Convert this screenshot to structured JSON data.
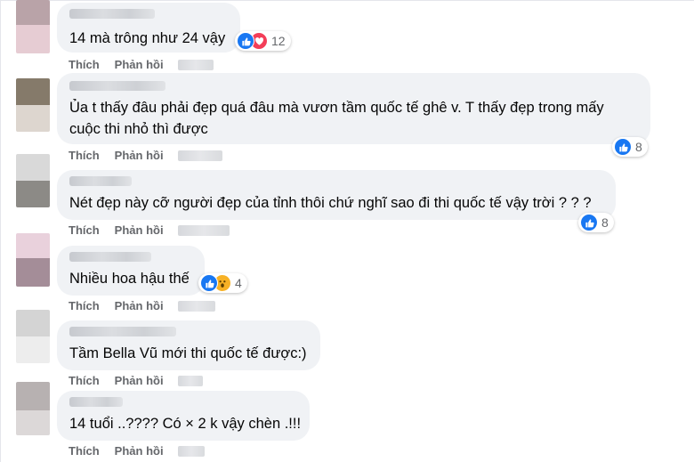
{
  "actions": {
    "like": "Thích",
    "reply": "Phản hồi"
  },
  "colors": {
    "bubble": "#f0f2f5",
    "like": "#1877f2",
    "love": "#f33e58",
    "wow": "#f7b125",
    "meta": "#65676b"
  },
  "comments": [
    {
      "lines": [
        "14 mà trông như 24 vậy"
      ],
      "reactions": [
        "like-icon",
        "love-icon"
      ],
      "count": "12"
    },
    {
      "lines": [
        "Ủa t thấy đâu phải đẹp quá đâu mà vươn tầm quốc tế ghê v. T thấy đẹp trong mấy",
        "cuộc thi nhỏ thì được"
      ],
      "reactions": [
        "like-icon"
      ],
      "count": "8"
    },
    {
      "lines": [
        "Nét đẹp này cỡ người đẹp của tỉnh thôi chứ nghĩ sao đi thi quốc tế vậy trời ? ? ?"
      ],
      "reactions": [
        "like-icon"
      ],
      "count": "8"
    },
    {
      "lines": [
        "Nhiều hoa hậu thế"
      ],
      "reactions": [
        "like-icon",
        "wow-icon"
      ],
      "count": "4"
    },
    {
      "lines": [
        "Tầm Bella Vũ mới thi quốc tế được:)"
      ],
      "reactions": [],
      "count": ""
    },
    {
      "lines": [
        "14 tuổi ..???? Có × 2 k vậy chèn .!!!"
      ],
      "reactions": [],
      "count": ""
    }
  ]
}
